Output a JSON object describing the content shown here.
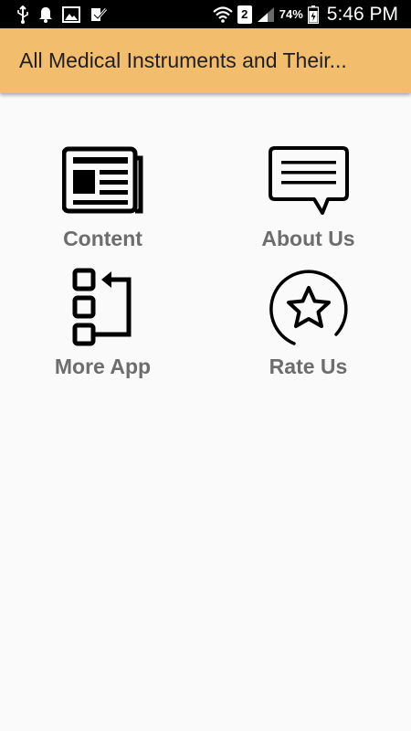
{
  "status_bar": {
    "icons": [
      "usb-icon",
      "bell-icon",
      "image-icon",
      "task-check-icon",
      "wifi-icon",
      "sim-icon",
      "signal-icon",
      "battery-icon"
    ],
    "sim_number": "2",
    "battery": "74%",
    "time": "5:46 PM"
  },
  "app_bar": {
    "title": "All Medical Instruments and Their..."
  },
  "menu": [
    {
      "label": "Content",
      "icon": "newspaper-icon"
    },
    {
      "label": "About Us",
      "icon": "chat-bubble-icon"
    },
    {
      "label": "More App",
      "icon": "app-list-icon"
    },
    {
      "label": "Rate Us",
      "icon": "star-icon"
    }
  ],
  "colors": {
    "app_bar": "#f2bd6c",
    "background": "#fafafa",
    "label": "#6d6d6d",
    "status_bar": "#000000"
  }
}
